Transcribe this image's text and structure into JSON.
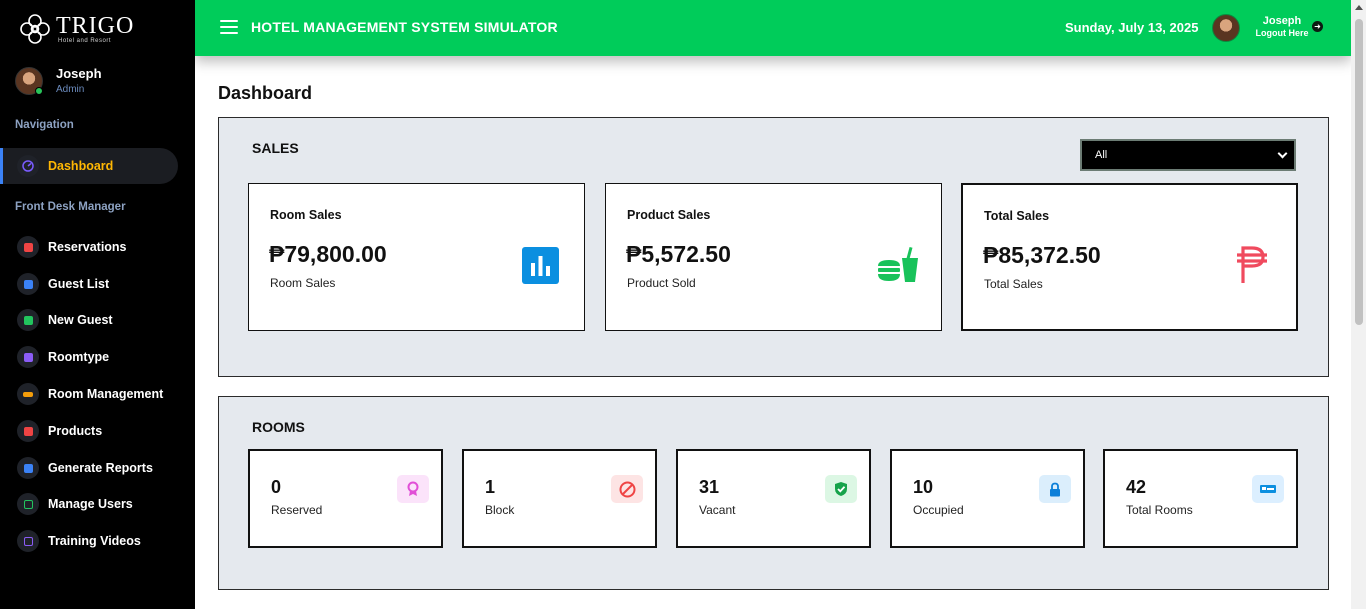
{
  "sidebar": {
    "brand_name": "TRIGO",
    "brand_sub": "Hotel and Resort",
    "user_name": "Joseph",
    "user_role": "Admin",
    "navigation_label": "Navigation",
    "front_desk_label": "Front Desk Manager",
    "items": [
      {
        "label": "Dashboard",
        "icon": "speedometer-icon",
        "color": "#7b5cff"
      },
      {
        "label": "Reservations",
        "icon": "clipboard-icon",
        "color": "#ef4444"
      },
      {
        "label": "Guest List",
        "icon": "book-icon",
        "color": "#3b82f6"
      },
      {
        "label": "New Guest",
        "icon": "calendar-icon",
        "color": "#22c55e"
      },
      {
        "label": "Roomtype",
        "icon": "room-type-icon",
        "color": "#8b5cf6"
      },
      {
        "label": "Room Management",
        "icon": "ticket-icon",
        "color": "#f59e0b"
      },
      {
        "label": "Products",
        "icon": "products-icon",
        "color": "#ef4444"
      },
      {
        "label": "Generate Reports",
        "icon": "printer-icon",
        "color": "#3b82f6"
      },
      {
        "label": "Manage Users",
        "icon": "user-card-icon",
        "color": "#22c55e"
      },
      {
        "label": "Training Videos",
        "icon": "video-icon",
        "color": "#8b5cf6"
      }
    ]
  },
  "header": {
    "title": "HOTEL MANAGEMENT SYSTEM SIMULATOR",
    "date": "Sunday, July 13, 2025",
    "user_name": "Joseph",
    "logout_label": "Logout Here"
  },
  "main": {
    "page_title": "Dashboard",
    "sales": {
      "title": "SALES",
      "filter_value": "All",
      "cards": [
        {
          "title": "Room Sales",
          "value": "₱79,800.00",
          "sub": "Room Sales",
          "icon": "bar-chart-icon",
          "color": "#0b8fe0"
        },
        {
          "title": "Product Sales",
          "value": "₱5,572.50",
          "sub": "Product Sold",
          "icon": "food-drink-icon",
          "color": "#18c25a"
        },
        {
          "title": "Total Sales",
          "value": "₱85,372.50",
          "sub": "Total Sales",
          "icon": "peso-icon",
          "color": "#f04a5e"
        }
      ]
    },
    "rooms": {
      "title": "ROOMS",
      "cards": [
        {
          "value": "0",
          "label": "Reserved",
          "icon": "ribbon-icon",
          "color": "#e14fd7",
          "bg": "#fbe3fa"
        },
        {
          "value": "1",
          "label": "Block",
          "icon": "block-icon",
          "color": "#ef4444",
          "bg": "#fde4e4"
        },
        {
          "value": "31",
          "label": "Vacant",
          "icon": "shield-check-icon",
          "color": "#16a34a",
          "bg": "#dcf7e4"
        },
        {
          "value": "10",
          "label": "Occupied",
          "icon": "lock-icon",
          "color": "#0b7fd9",
          "bg": "#dbeefc"
        },
        {
          "value": "42",
          "label": "Total Rooms",
          "icon": "bed-icon",
          "color": "#0b8fe0",
          "bg": "#dcefff"
        }
      ]
    }
  }
}
